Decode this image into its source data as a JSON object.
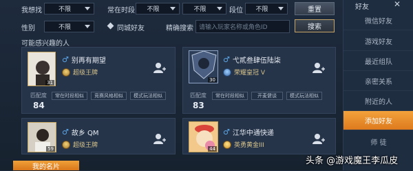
{
  "filters": {
    "want_find_label": "我想找",
    "want_find_value": "不限",
    "online_time_label": "常在时段",
    "online_time_value1": "不限",
    "online_time_value2": "不限",
    "tier_label": "段位",
    "tier_value": "不限",
    "reset_label": "重置",
    "gender_label": "性别",
    "gender_value": "不限",
    "same_city_label": "同城好友",
    "precise_search_label": "精确搜索",
    "search_placeholder": "请输入玩家名称或角色ID",
    "search_button": "搜索"
  },
  "section_title": "可能感兴趣的人",
  "cards": [
    {
      "name": "别再有期望",
      "level": "31",
      "rank": "超级王牌",
      "match_label": "匹配度",
      "match_value": "84",
      "tags": [
        "常在时段相似",
        "竞赛风格相似",
        "模式玩法相似"
      ]
    },
    {
      "name": "弋貳叁肆伍陆柒",
      "level": "30",
      "rank": "荣耀皇冠 V",
      "match_label": "匹配度",
      "match_value": "83",
      "tags": [
        "常在时段相似",
        "开麦健谈",
        "模式玩法相似"
      ]
    },
    {
      "name": "故乡 QM",
      "level": "59",
      "rank": "超级王牌",
      "tags": []
    },
    {
      "name": "江华中通快递",
      "level": "44",
      "rank": "英勇黄金III",
      "tags": []
    }
  ],
  "my_card_button": "我的名片",
  "sidebar": {
    "title": "好友",
    "items": [
      "微信好友",
      "游戏好友",
      "最近组队",
      "亲密关系",
      "附近的人",
      "添加好友",
      "师 徒"
    ],
    "active_index": 5
  },
  "watermark": "头条 @游戏魔王李瓜皮",
  "icons": {
    "close": "close-icon",
    "add_friend": "add-friend-icon",
    "gender": "male-icon",
    "rank": "rank-badge-icon",
    "diamond": "diamond-icon"
  }
}
